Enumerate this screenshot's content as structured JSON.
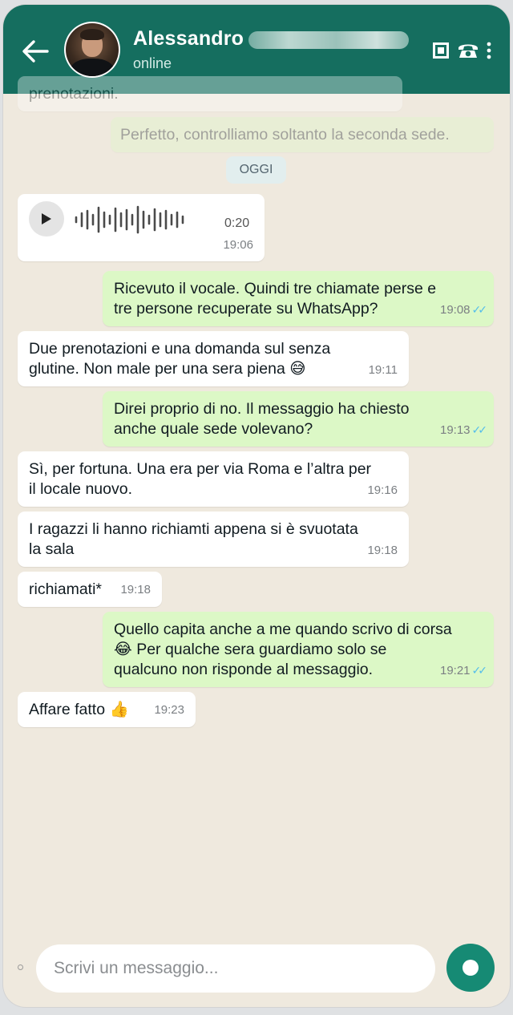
{
  "header": {
    "contact_name": "Alessandro",
    "status": "online",
    "icons": [
      "back-arrow-icon",
      "avatar",
      "video-call-icon",
      "phone-icon",
      "more-options-icon"
    ]
  },
  "chat": {
    "faded_prev_incoming": "prenotazioni.",
    "faded_prev_outgoing": "Perfetto, controlliamo soltanto la seconda sede.",
    "day_label": "OGGI",
    "voice_note": {
      "duration": "0:20",
      "time": "19:06"
    },
    "messages": [
      {
        "dir": "out",
        "lines": [
          "Ricevuto il vocale. Quindi tre chiamate perse e",
          "tre persone recuperate su WhatsApp?"
        ],
        "time": "19:08",
        "ticks": "✓✓"
      },
      {
        "dir": "in",
        "lines": [
          "Due prenotazioni e una domanda sul senza",
          "glutine. Non male per una sera piena 😅"
        ],
        "time": "19:11"
      },
      {
        "dir": "out",
        "lines": [
          "Direi proprio di no. Il messaggio ha chiesto",
          "anche quale sede volevano?"
        ],
        "time": "19:13",
        "ticks": "✓✓"
      },
      {
        "dir": "in",
        "lines": [
          "Sì, per fortuna. Una era per via Roma e l’altra per",
          "il locale nuovo."
        ],
        "time": "19:16"
      },
      {
        "dir": "in",
        "lines": [
          "I ragazzi li hanno richiamti appena si è svuotata",
          "la sala"
        ],
        "time": "19:18"
      },
      {
        "dir": "in",
        "lines": [
          "richiamati*"
        ],
        "time": "19:18"
      },
      {
        "dir": "out",
        "lines": [
          "Quello capita anche a me quando scrivo di corsa",
          "😂 Per qualche sera guardiamo solo se",
          "qualcuno non risponde al messaggio."
        ],
        "time": "19:21",
        "ticks": "✓✓"
      },
      {
        "dir": "in",
        "lines": [
          "Affare fatto 👍"
        ],
        "time": "19:23"
      }
    ]
  },
  "composer": {
    "placeholder": "Scrivi un messaggio..."
  },
  "colors": {
    "header": "#156e5f",
    "outgoing_bubble": "#dcf8c6",
    "incoming_bubble": "#ffffff",
    "background": "#efe9de",
    "send_button": "#168a74",
    "read_ticks": "#53bdeb"
  }
}
